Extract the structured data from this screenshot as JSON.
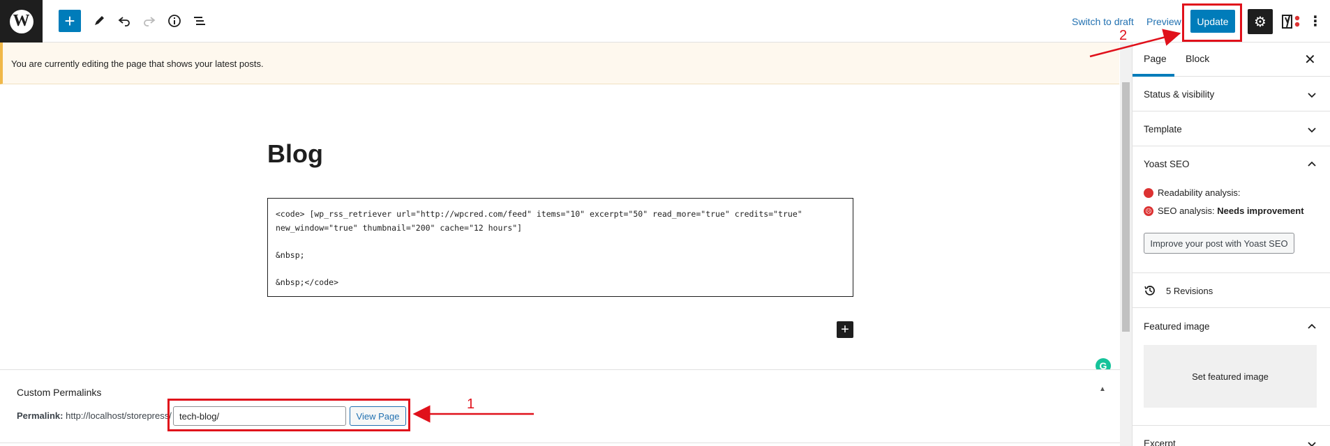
{
  "toolbar": {
    "logo_letter": "W",
    "switch_to_draft": "Switch to draft",
    "preview": "Preview",
    "update": "Update",
    "icons": [
      "wordpress-logo",
      "plus-icon",
      "pencil-icon",
      "undo-icon",
      "redo-icon",
      "info-icon",
      "list-view-icon",
      "gear-icon",
      "yoast-icon",
      "more-icon"
    ]
  },
  "notice": {
    "text": "You are currently editing the page that shows your latest posts."
  },
  "editor": {
    "title": "Blog",
    "code_lines": [
      "<code> [wp_rss_retriever url=\"http://wpcred.com/feed\" items=\"10\" excerpt=\"50\" read_more=\"true\" credits=\"true\"",
      "new_window=\"true\" thumbnail=\"200\" cache=\"12 hours\"]",
      "",
      "&nbsp;",
      "",
      "&nbsp;</code>"
    ]
  },
  "metabox": {
    "title": "Custom Permalinks",
    "permalink_label": "Permalink:",
    "permalink_base": "http://localhost/storepress/",
    "slug_value": "tech-blog/",
    "view_page": "View Page"
  },
  "sidebar": {
    "tabs": [
      "Page",
      "Block"
    ],
    "sections": {
      "status": "Status & visibility",
      "template": "Template",
      "yoast": "Yoast SEO",
      "revisions": "5 Revisions",
      "featured": "Featured image",
      "excerpt": "Excerpt"
    },
    "yoast": {
      "readability": "Readability analysis:",
      "seo_label": "SEO analysis:",
      "seo_value": "Needs improvement",
      "improve_button": "Improve your post with Yoast SEO"
    },
    "featured_button": "Set featured image"
  },
  "annotations": {
    "label_1": "1",
    "label_2": "2"
  },
  "colors": {
    "accent": "#007cba",
    "annotation_red": "#e0111b",
    "notice_border": "#f0b849",
    "yoast_bad": "#dc3232"
  }
}
